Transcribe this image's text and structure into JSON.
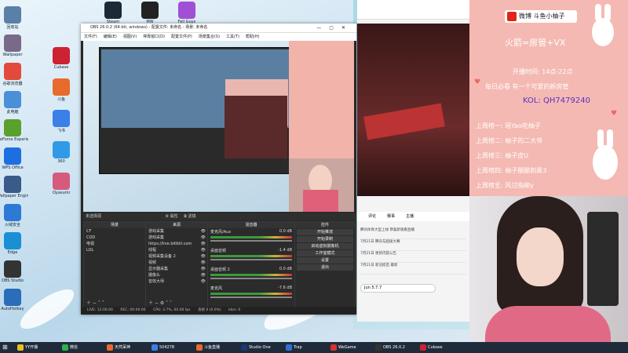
{
  "desktop_icons": [
    {
      "label": "回收站",
      "color": "#5a7fa8"
    },
    {
      "label": "Wallpaper",
      "color": "#7a6a8a"
    },
    {
      "label": "谷歌浏览器",
      "color": "#e24b3c"
    },
    {
      "label": "此电脑",
      "color": "#4a90d9"
    },
    {
      "label": "GeForce Experience",
      "color": "#5aa02c"
    },
    {
      "label": "WPS Office",
      "color": "#1d6fe0"
    },
    {
      "label": "Wallpaper Engine",
      "color": "#3a5a8a"
    },
    {
      "label": "火绒安全",
      "color": "#2d7ad6"
    },
    {
      "label": "Edge",
      "color": "#1a8fd6"
    },
    {
      "label": "OBS Studio",
      "color": "#333"
    },
    {
      "label": "AutoHotkey",
      "color": "#2a6db8"
    }
  ],
  "desktop_icons_col2": [
    {
      "label": "Cubase",
      "color": "#c23"
    },
    {
      "label": "斗鱼",
      "color": "#e86a2c"
    },
    {
      "label": "飞书",
      "color": "#3b7fe8"
    },
    {
      "label": "360",
      "color": "#2f9be8"
    },
    {
      "label": "Oyasumi",
      "color": "#d65a7c"
    }
  ],
  "top_icons": [
    {
      "label": "Steam",
      "color": "#1b2838"
    },
    {
      "label": "MW",
      "color": "#222"
    },
    {
      "label": "Fall Guys",
      "color": "#a24fd6"
    }
  ],
  "obs": {
    "title": "OBS 26.0.2 (64-bit, windows) - 配置文件: 未命名 - 场景: 未命名",
    "menu": [
      "文件(F)",
      "编辑(E)",
      "视图(V)",
      "停靠窗口(D)",
      "配置文件(P)",
      "场景集合(S)",
      "工具(T)",
      "帮助(H)"
    ],
    "source_bar": "未选择源",
    "panels": {
      "scenes": {
        "title": "场景",
        "items": [
          "CF",
          "COD",
          "电视",
          "LOL"
        ]
      },
      "sources": {
        "title": "来源",
        "items": [
          "游戏采集",
          "游戏采集",
          "https://live.bilibili.com",
          "线程",
          "视频采集设备 2",
          "视频",
          "显示器采集",
          "摄像头",
          "音效大师"
        ]
      },
      "mixer": {
        "title": "混音器",
        "tracks": [
          "麦克风/Aux",
          "桌面音频",
          "桌面音频 2",
          "麦克风"
        ],
        "values": [
          "0.0 dB",
          "-1.4 dB",
          "0.0 dB",
          "-7.6 dB"
        ]
      },
      "controls": {
        "title": "控件",
        "buttons": [
          "开始推流",
          "开始录制",
          "启动虚拟摄像机",
          "工作室模式",
          "设置",
          "退出"
        ]
      }
    },
    "status": {
      "live": "LIVE: 12:00:00",
      "rec": "REC: 00:00:00",
      "cpu": "CPU: 3.7%, 60.00 fps",
      "dropped": "丢帧 0 (0.0%)",
      "kbps": "kb/s: 0"
    }
  },
  "info_panel": {
    "weibo": "微博 斗鱼小柚子",
    "line1": "火箭=房管+VX",
    "line2": "开播时间: 14点-22点",
    "line3": "每日必看 有一个可爱的新房管",
    "kol": "KOL: QH7479240",
    "rank": [
      "上周榜一: 瑶Yao吃柚子",
      "上周榜二: 柚子的二大爷",
      "上周榜三: 柚子皮U",
      "上周榜四: 柚子醋醋刺鼻3",
      "上周榜五: 风过指柳y"
    ]
  },
  "browser": {
    "tabs": [
      "评论",
      "赛事",
      "主播"
    ],
    "news": [
      "腾讯体育大型上线 恭喜新观看直播",
      "7月21日 腾讯与超级大赛",
      "7月21日 更新内容公告",
      "7月21日 新冠疫苗 最新"
    ],
    "chip": "Jun 5.7.7"
  },
  "taskbar": {
    "items": [
      "YY开播",
      "微信",
      "天然呆神",
      "504278",
      "斗鱼直播",
      "Studio One",
      "Trap",
      "WeGame",
      "OBS 26.0.2",
      "Cubase"
    ],
    "clock": "",
    "colors": [
      "#e8c020",
      "#2bb24c",
      "#e86a2c",
      "#3b7fe8",
      "#e86a2c",
      "#1b3a6e",
      "#2f6fd6",
      "#d63333",
      "#333",
      "#c23"
    ]
  }
}
